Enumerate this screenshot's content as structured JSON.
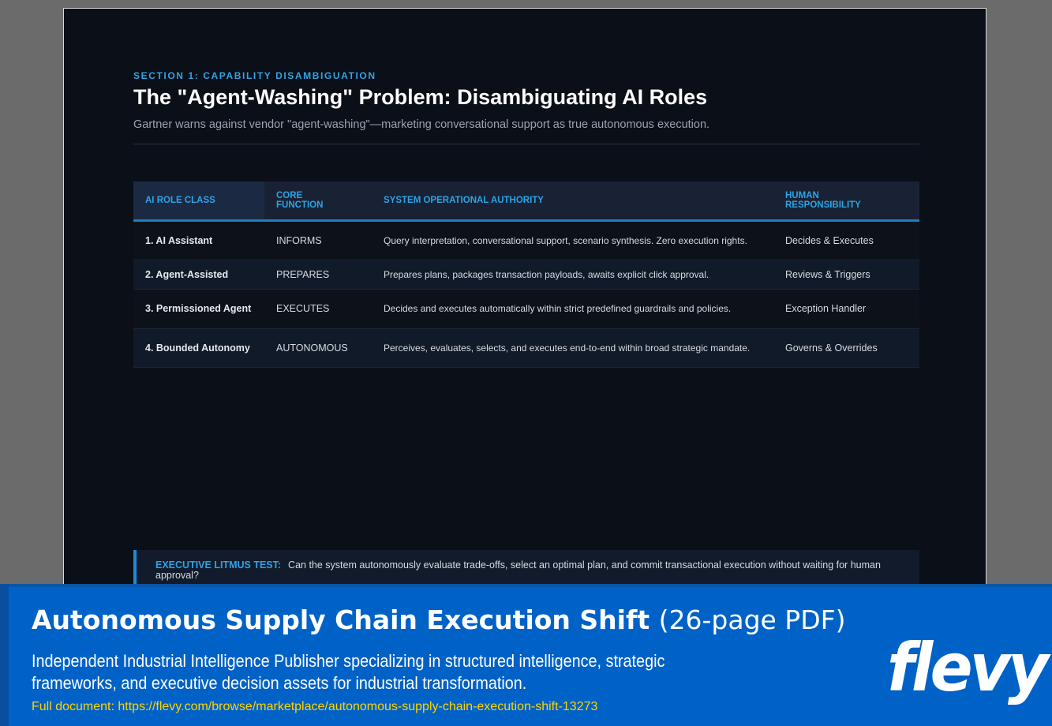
{
  "slide": {
    "section_label": "SECTION 1: CAPABILITY DISAMBIGUATION",
    "title": "The \"Agent-Washing\" Problem: Disambiguating AI Roles",
    "subtitle": "Gartner warns against vendor \"agent-washing\"—marketing conversational support as true autonomous execution."
  },
  "table": {
    "headers": {
      "role": "AI ROLE CLASS",
      "function_line1": "CORE",
      "function_line2": "FUNCTION",
      "authority": "SYSTEM OPERATIONAL AUTHORITY",
      "human_line1": "HUMAN",
      "human_line2": "RESPONSIBILITY"
    },
    "rows": [
      {
        "role": "1. AI Assistant",
        "function": "INFORMS",
        "authority": "Query interpretation, conversational support, scenario synthesis. Zero execution rights.",
        "human": "Decides & Executes"
      },
      {
        "role": "2. Agent-Assisted",
        "function": "PREPARES",
        "authority": "Prepares plans, packages transaction payloads, awaits explicit click approval.",
        "human": "Reviews & Triggers"
      },
      {
        "role": "3. Permissioned Agent",
        "function": "EXECUTES",
        "authority": "Decides and executes automatically within strict predefined guardrails and policies.",
        "human": "Exception Handler"
      },
      {
        "role": "4. Bounded Autonomy",
        "function": "AUTONOMOUS",
        "authority": "Perceives, evaluates, selects, and executes end-to-end within broad strategic mandate.",
        "human": "Governs & Overrides"
      }
    ]
  },
  "litmus": {
    "label": "EXECUTIVE LITMUS TEST:",
    "text": "Can the system autonomously evaluate trade-offs, select an optimal plan, and commit transactional execution without waiting for human approval?"
  },
  "banner": {
    "title": "Autonomous Supply Chain Execution Shift",
    "pages": "(26-page PDF)",
    "description": "Independent Industrial Intelligence Publisher specializing in structured intelligence, strategic frameworks, and executive decision assets for industrial transformation.",
    "link": "Full document: https://flevy.com/browse/marketplace/autonomous-supply-chain-execution-shift-13273",
    "logo": "flevy"
  },
  "colors": {
    "accent": "#2fa3e6",
    "slide_bg": "#0b0f17",
    "banner_bg": "#0062c7",
    "link": "#ffd400"
  }
}
